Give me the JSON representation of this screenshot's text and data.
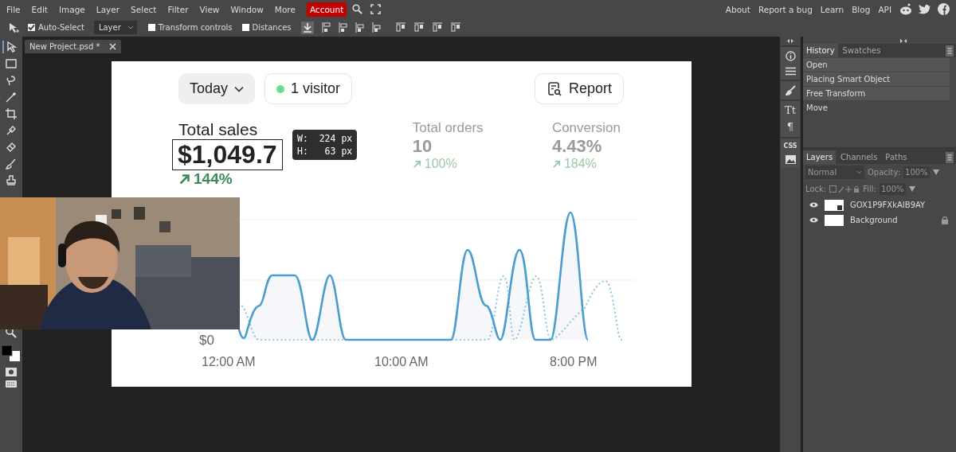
{
  "menu": [
    "File",
    "Edit",
    "Image",
    "Layer",
    "Select",
    "Filter",
    "View",
    "Window",
    "More"
  ],
  "account": "Account",
  "links": [
    "About",
    "Report a bug",
    "Learn",
    "Blog",
    "API"
  ],
  "toolbar": {
    "auto_select": {
      "label": "Auto-Select",
      "checked": true
    },
    "target": "Layer",
    "transform_controls": {
      "label": "Transform controls",
      "checked": false
    },
    "distances": {
      "label": "Distances",
      "checked": false
    }
  },
  "document_tab": {
    "title": "New Project.psd *",
    "selected": true
  },
  "side_tools": {
    "type_icons": [
      "Tt",
      "¶"
    ],
    "css_label": "CSS"
  },
  "history": {
    "tabs": [
      {
        "label": "History",
        "selected": true
      },
      {
        "label": "Swatches",
        "selected": false
      }
    ],
    "items": [
      {
        "label": "Open",
        "selected": false
      },
      {
        "label": "Placing Smart Object",
        "selected": false
      },
      {
        "label": "Free Transform",
        "selected": false
      },
      {
        "label": "Move",
        "selected": true
      }
    ]
  },
  "layers": {
    "tabs": [
      {
        "label": "Layers",
        "selected": true
      },
      {
        "label": "Channels",
        "selected": false
      },
      {
        "label": "Paths",
        "selected": false
      }
    ],
    "blend_mode": "Normal",
    "opacity_label": "Opacity:",
    "opacity": "100%",
    "lock_label": "Lock:",
    "fill_label": "Fill:",
    "fill": "100%",
    "items": [
      {
        "name": "GOX1P9FXkAIB9AY",
        "visible": true,
        "locked": false
      },
      {
        "name": "Background",
        "visible": true,
        "locked": true
      }
    ]
  },
  "canvas": {
    "range": "Today",
    "visitors": "1 visitor",
    "report": "Report",
    "metrics": [
      {
        "label": "Total sales",
        "value": "$1,049.7",
        "change": "144%",
        "selected": true
      },
      {
        "label": "Total orders",
        "value": "10",
        "change": "100%",
        "selected": false
      },
      {
        "label": "Conversion",
        "value": "4.43%",
        "change": "184%",
        "selected": false
      }
    ],
    "measure": {
      "width": "W:  224 px",
      "height": "H:   63 px"
    },
    "chart": {
      "y_label": "$0",
      "x_labels": [
        "12:00 AM",
        "10:00 AM",
        "8:00 PM"
      ]
    }
  }
}
